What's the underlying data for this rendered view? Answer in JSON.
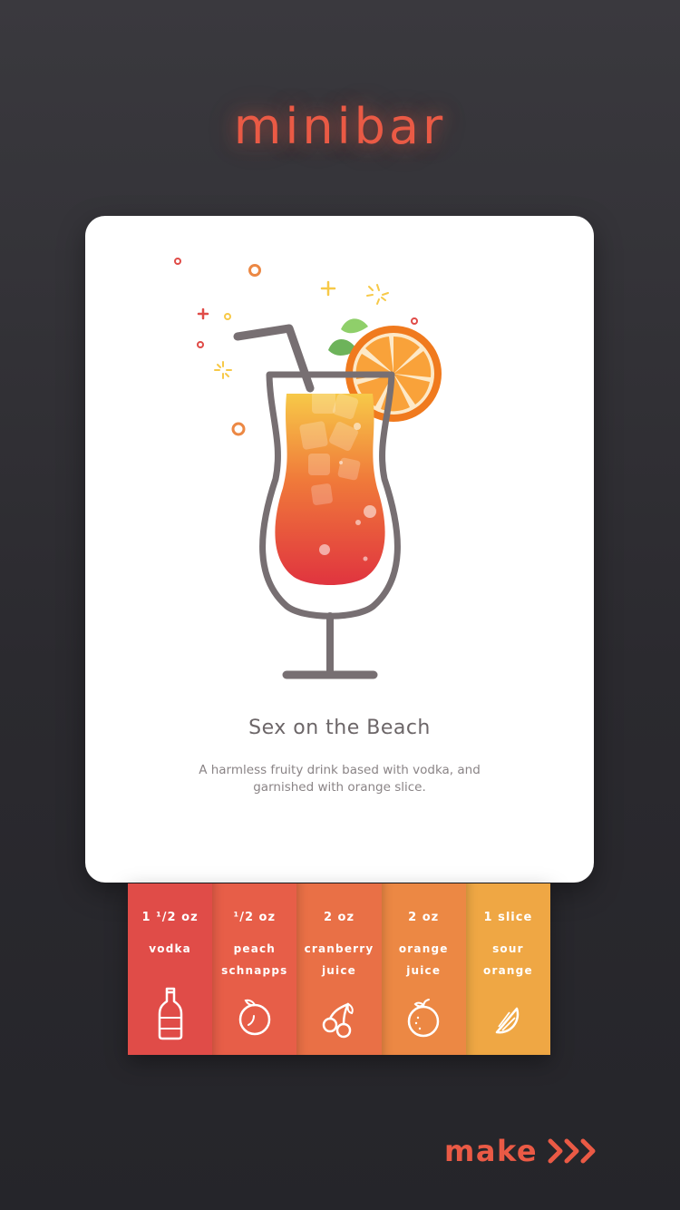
{
  "app": {
    "logo_text": "minibar",
    "accent_color": "#ea5a45"
  },
  "drink": {
    "title": "Sex on the Beach",
    "description": "A harmless fruity drink based with vodka, and garnished with orange slice."
  },
  "ingredients": [
    {
      "amount": "1 ¹/2 oz",
      "name": "vodka",
      "icon": "bottle-icon",
      "color": "#e04c48"
    },
    {
      "amount": "¹/2 oz",
      "name": "peach schnapps",
      "icon": "peach-icon",
      "color": "#e75e48"
    },
    {
      "amount": "2 oz",
      "name": "cranberry juice",
      "icon": "cherries-icon",
      "color": "#e97046"
    },
    {
      "amount": "2 oz",
      "name": "orange juice",
      "icon": "orange-icon",
      "color": "#ec8844"
    },
    {
      "amount": "1 slice",
      "name": "sour orange",
      "icon": "orange-slice-icon",
      "color": "#efa744"
    }
  ],
  "action": {
    "make_label": "make",
    "icon": "triple-chevron-right-icon"
  }
}
